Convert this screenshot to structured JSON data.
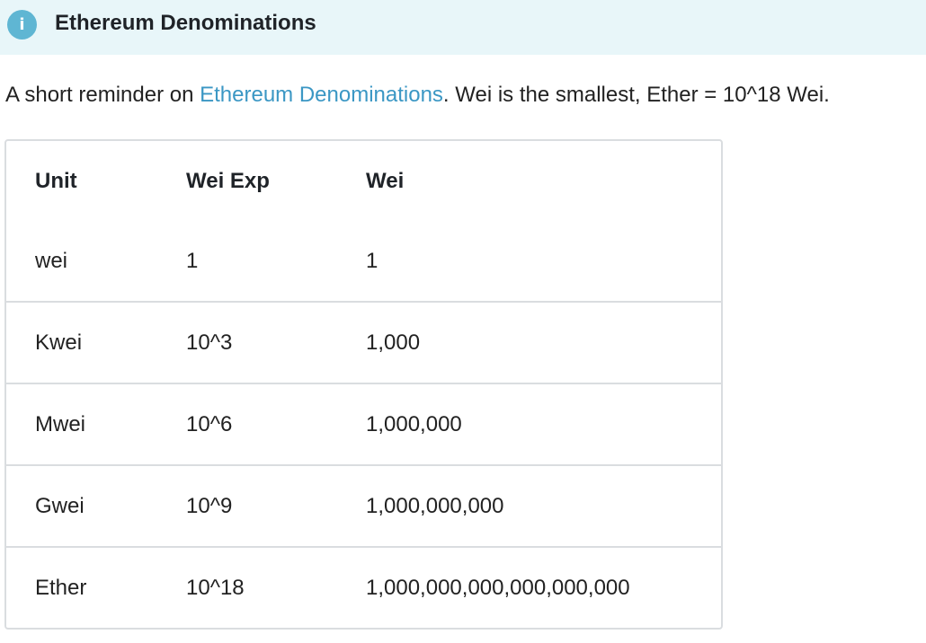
{
  "callout": {
    "icon": "info-icon",
    "icon_glyph": "i",
    "title": "Ethereum Denominations",
    "bg_color": "#e8f6f9",
    "icon_color": "#5fb6d3"
  },
  "intro": {
    "before": "A short reminder on ",
    "link": "Ethereum Denominations",
    "after": ". Wei is the smallest, Ether = 10^18 Wei.",
    "link_color": "#3b97c4"
  },
  "table": {
    "headers": [
      "Unit",
      "Wei Exp",
      "Wei"
    ],
    "rows": [
      [
        "wei",
        "1",
        "1"
      ],
      [
        "Kwei",
        "10^3",
        "1,000"
      ],
      [
        "Mwei",
        "10^6",
        "1,000,000"
      ],
      [
        "Gwei",
        "10^9",
        "1,000,000,000"
      ],
      [
        "Ether",
        "10^18",
        "1,000,000,000,000,000,000"
      ]
    ]
  }
}
